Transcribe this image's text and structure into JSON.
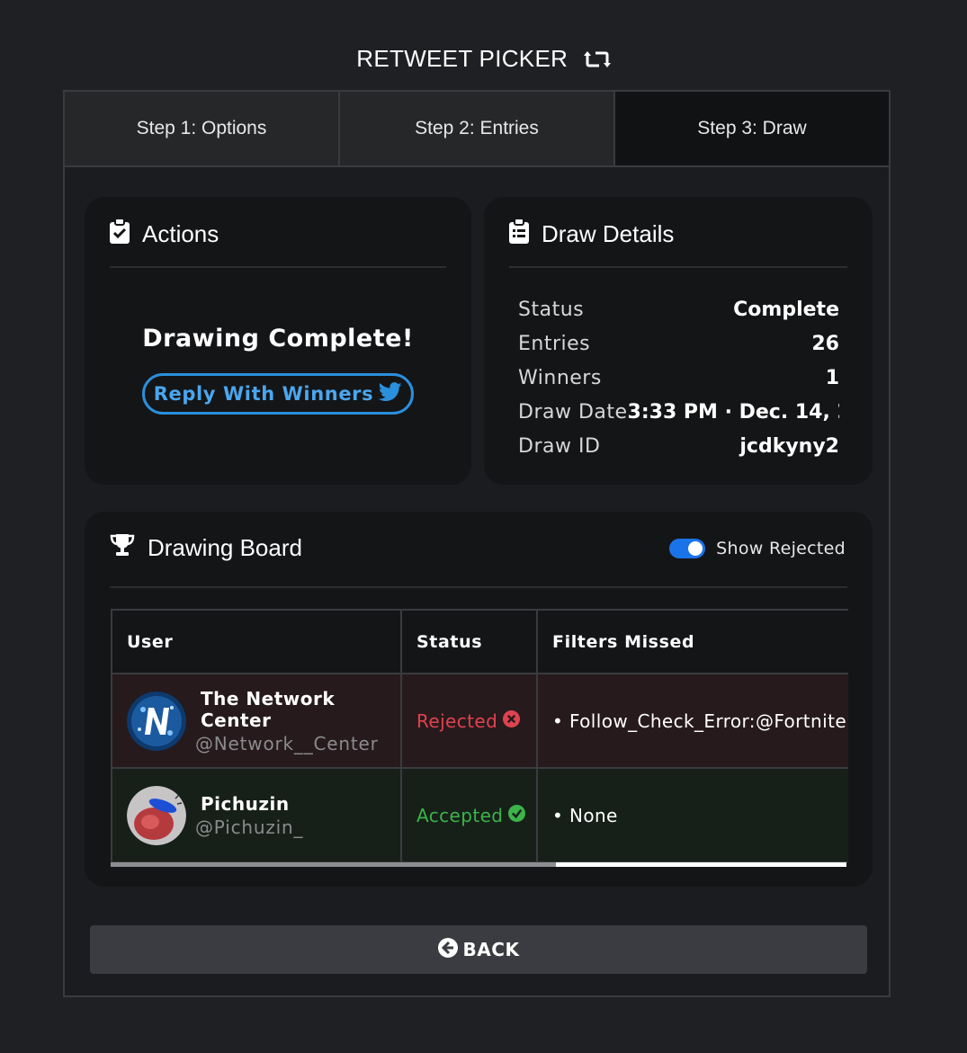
{
  "app": {
    "title": "RETWEET PICKER"
  },
  "tabs": [
    {
      "label": "Step 1: Options"
    },
    {
      "label": "Step 2: Entries"
    },
    {
      "label": "Step 3: Draw",
      "active": true
    }
  ],
  "actions": {
    "title": "Actions",
    "message": "Drawing Complete!",
    "reply_label": "Reply With Winners"
  },
  "details": {
    "title": "Draw Details",
    "rows": [
      {
        "key": "Status",
        "value": "Complete"
      },
      {
        "key": "Entries",
        "value": "26"
      },
      {
        "key": "Winners",
        "value": "1"
      },
      {
        "key": "Draw Date",
        "value": "3:33 PM · Dec. 14, 2"
      },
      {
        "key": "Draw ID",
        "value": "jcdkyny2"
      }
    ]
  },
  "board": {
    "title": "Drawing Board",
    "toggle_label": "Show Rejected",
    "toggle_on": true,
    "columns": [
      "User",
      "Status",
      "Filters Missed"
    ],
    "rows": [
      {
        "name": "The Network Center",
        "handle": "@Network__Center",
        "status": "Rejected",
        "filters": "• Follow_Check_Error:@Fortnite"
      },
      {
        "name": "Pichuzin",
        "handle": "@Pichuzin_",
        "status": "Accepted",
        "filters": "• None"
      }
    ]
  },
  "back": {
    "label": "BACK"
  },
  "colors": {
    "accent": "#1a73e8",
    "twitter_blue": "#2a8fdd",
    "rejected": "#e0424f",
    "accepted": "#3cb34a"
  }
}
